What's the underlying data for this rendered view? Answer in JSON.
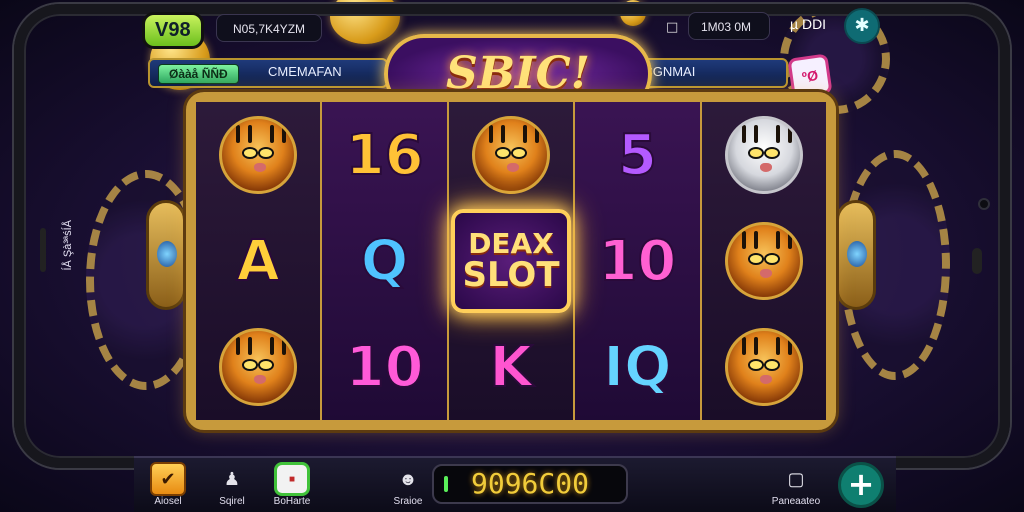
{
  "device": {
    "side_label": "ÍÅ Şà³ªśÍÅ"
  },
  "hud": {
    "logo": "V98",
    "balance_label": "N05,7K4YZM",
    "coins_label": "1M03 0M",
    "user_label": "µ DDI",
    "settings_icon": "settings-icon"
  },
  "banner": {
    "badge_label": "Øààå ÑÑÐ",
    "left_text": "CMEMAFAN",
    "title": "SBIC!",
    "right_text": "SACGNMAI",
    "bonus_label": "ºØ"
  },
  "reels": {
    "columns": [
      [
        {
          "type": "tiger"
        },
        {
          "type": "letter",
          "text": "A",
          "color": "#ffcf3a"
        },
        {
          "type": "tiger"
        }
      ],
      [
        {
          "type": "letter",
          "text": "16",
          "color": "#ffc236"
        },
        {
          "type": "letter",
          "text": "Q",
          "color": "#4fc3ff"
        },
        {
          "type": "letter",
          "text": "10",
          "color": "#ff5ad8"
        }
      ],
      [
        {
          "type": "tiger"
        },
        {
          "type": "wild",
          "line1": "DEAX",
          "line2": "SLOT"
        },
        {
          "type": "letter",
          "text": "K",
          "color": "#ff55d0"
        }
      ],
      [
        {
          "type": "letter",
          "text": "5",
          "color": "#b45aff"
        },
        {
          "type": "letter",
          "text": "10",
          "color": "#ff60d2"
        },
        {
          "type": "letter",
          "text": "IQ",
          "color": "#65d4ff"
        }
      ],
      [
        {
          "type": "tiger",
          "variant": "white"
        },
        {
          "type": "tiger"
        },
        {
          "type": "tiger"
        }
      ]
    ]
  },
  "bottom": {
    "items": [
      {
        "label": "Aiosel",
        "icon": "check-icon"
      },
      {
        "label": "Sqirel",
        "icon": "person-icon"
      },
      {
        "label": "BoHarte",
        "icon": "gift-icon"
      },
      {
        "label": "Sraioe",
        "icon": "user-icon"
      }
    ],
    "credit": "9096C00",
    "right_label": "Paneaateo",
    "add_icon": "plus-icon"
  }
}
